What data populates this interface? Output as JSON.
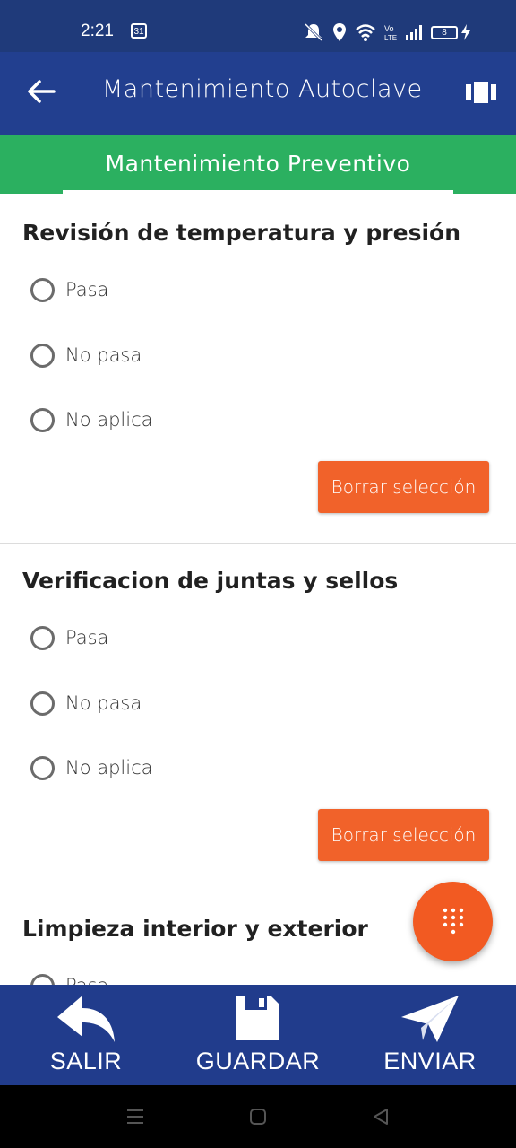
{
  "status_bar": {
    "time": "2:21",
    "calendar_badge": "31",
    "battery_level": "8",
    "icons": [
      "mute-icon",
      "location-icon",
      "wifi-icon",
      "volte-icon",
      "signal-icon",
      "battery-icon",
      "charging-icon"
    ]
  },
  "app_bar": {
    "title": "Mantenimiento Autoclave",
    "back_icon": "arrow-left-icon",
    "action_icon": "view-columns-icon"
  },
  "tab": {
    "label": "Mantenimiento Preventivo"
  },
  "questions": [
    {
      "title": "Revisión de temperatura y presión",
      "options": [
        "Pasa",
        "No pasa",
        "No aplica"
      ],
      "clear_label": "Borrar selección"
    },
    {
      "title": "Verificacion de juntas y sellos",
      "options": [
        "Pasa",
        "No pasa",
        "No aplica"
      ],
      "clear_label": "Borrar selección"
    },
    {
      "title": "Limpieza interior y exterior",
      "options": [
        "Pasa"
      ]
    }
  ],
  "fab": {
    "icon": "dialpad-icon"
  },
  "bottom_bar": {
    "exit_label": "SALIR",
    "save_label": "GUARDAR",
    "send_label": "ENVIAR"
  },
  "colors": {
    "status_bar": "#1f3a7a",
    "app_bar": "#223f8f",
    "tab_bar": "#2bb060",
    "accent": "#f1622a",
    "bottom_bar": "#213c8c"
  }
}
